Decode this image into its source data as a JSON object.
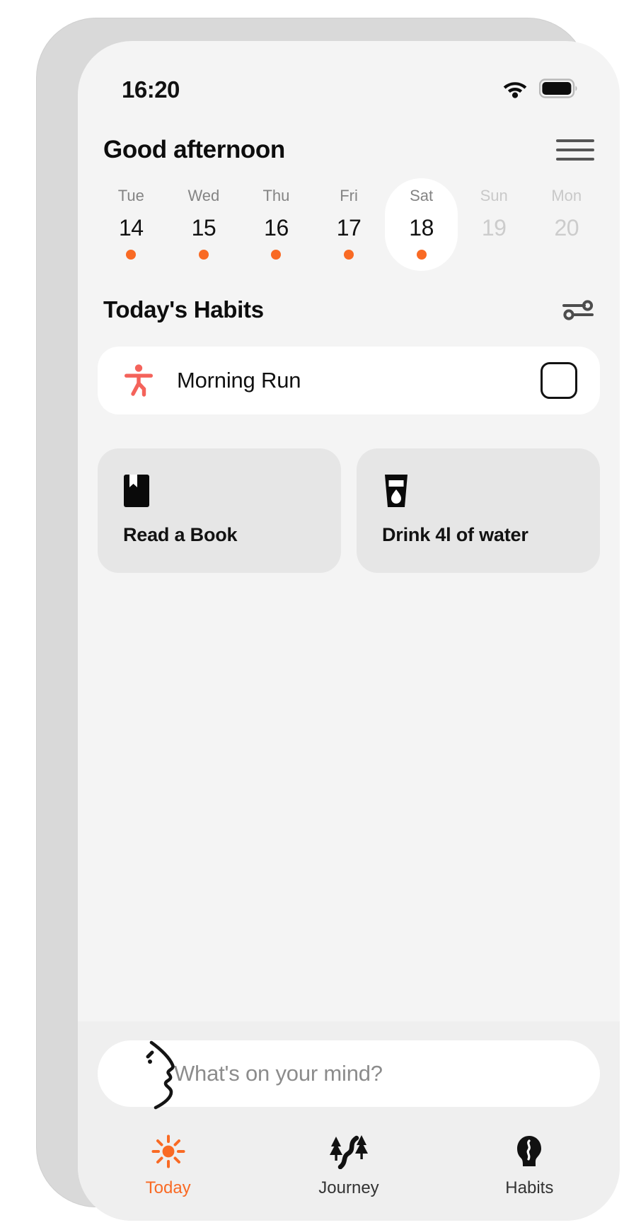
{
  "theme": {
    "accent": "#f96a24",
    "runner_icon_color": "#f4635b",
    "screen_bg": "#f4f4f4",
    "card_white": "#ffffff",
    "tile_grey": "#e6e6e6",
    "bottom_bg": "#efefef"
  },
  "status_bar": {
    "time": "16:20",
    "wifi_icon": "wifi-icon",
    "battery_icon": "battery-full-icon"
  },
  "header": {
    "greeting": "Good afternoon",
    "menu_icon": "hamburger-menu-icon"
  },
  "day_strip": {
    "days": [
      {
        "name": "Tue",
        "number": "14",
        "has_dot": true,
        "selected": false,
        "dim": false
      },
      {
        "name": "Wed",
        "number": "15",
        "has_dot": true,
        "selected": false,
        "dim": false
      },
      {
        "name": "Thu",
        "number": "16",
        "has_dot": true,
        "selected": false,
        "dim": false
      },
      {
        "name": "Fri",
        "number": "17",
        "has_dot": true,
        "selected": false,
        "dim": false
      },
      {
        "name": "Sat",
        "number": "18",
        "has_dot": true,
        "selected": true,
        "dim": false
      },
      {
        "name": "Sun",
        "number": "19",
        "has_dot": false,
        "selected": false,
        "dim": true
      },
      {
        "name": "Mon",
        "number": "20",
        "has_dot": false,
        "selected": false,
        "dim": true
      }
    ]
  },
  "habits_section": {
    "title": "Today's Habits",
    "filter_icon": "tune-sliders-icon",
    "primary_habit": {
      "label": "Morning Run",
      "icon": "running-person-icon",
      "checkbox_icon": "checkbox-unchecked-icon",
      "checked": false
    },
    "tiles": [
      {
        "label": "Read a Book",
        "icon": "book-bookmark-icon"
      },
      {
        "label": "Drink 4l of water",
        "icon": "water-glass-icon"
      }
    ]
  },
  "composer": {
    "placeholder": "What's on your mind?",
    "value": "",
    "avatar_icon": "face-profile-icon"
  },
  "tab_bar": {
    "items": [
      {
        "label": "Today",
        "icon": "sun-icon",
        "active": true
      },
      {
        "label": "Journey",
        "icon": "path-trees-icon",
        "active": false
      },
      {
        "label": "Habits",
        "icon": "head-brain-icon",
        "active": false
      }
    ]
  }
}
